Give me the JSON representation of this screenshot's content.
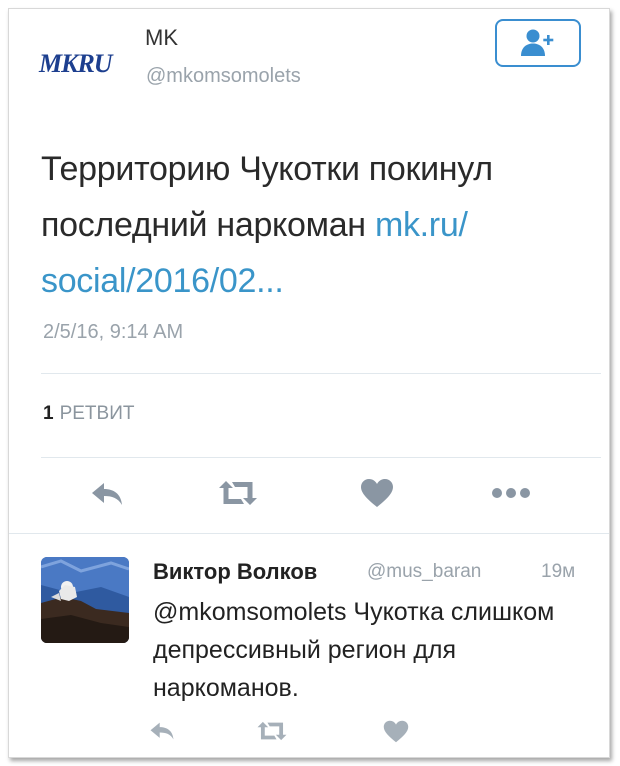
{
  "tweet": {
    "logo_text": "MKRU",
    "account_name": "MK",
    "account_handle": "@mkomsomolets",
    "follow_icon": "add-user-icon",
    "text_main": "Территорию Чукотки покинул последний наркоман ",
    "text_link": "mk.ru/ social/2016/02...",
    "timestamp": "2/5/16, 9:14 AM",
    "retweet_count": "1",
    "retweet_label": "РЕТВИТ",
    "actions": [
      "reply-icon",
      "retweet-icon",
      "like-icon",
      "more-icon"
    ]
  },
  "reply": {
    "name": "Виктор Волков",
    "handle": "@mus_baran",
    "time": "19м",
    "text": "@mkomsomolets Чукотка слишком депрессивный регион для наркоманов.",
    "actions": [
      "reply-icon",
      "retweet-icon",
      "like-icon"
    ]
  },
  "colors": {
    "link": "#3a95c9",
    "follow_border": "#3a8ed0",
    "secondary_text": "#9aa3ab",
    "action_icon": "#8a96a3",
    "logo": "#1d3f8f"
  }
}
